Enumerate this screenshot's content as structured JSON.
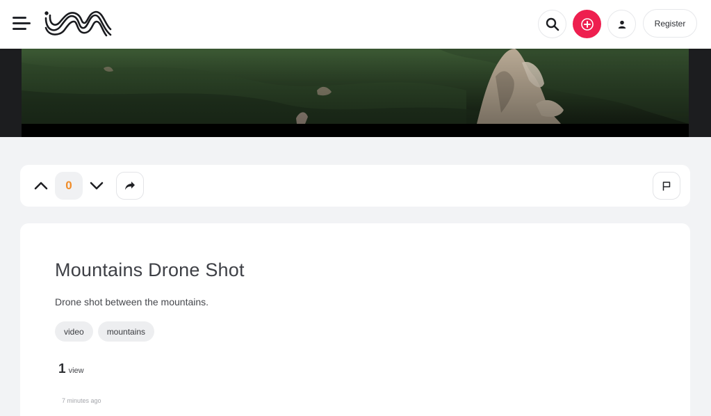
{
  "header": {
    "menu_icon": "hamburger-menu-icon",
    "logo_icon": "wave-logo-icon",
    "search_icon": "search-icon",
    "add_icon": "plus-circle-icon",
    "user_icon": "user-icon",
    "register_label": "Register",
    "accent_color": "#ee1f4f"
  },
  "video": {
    "thumbnail": "mountain-forest-aerial"
  },
  "actions": {
    "upvote_icon": "chevron-up-icon",
    "vote_count": "0",
    "downvote_icon": "chevron-down-icon",
    "share_icon": "share-arrow-icon",
    "report_icon": "flag-icon",
    "vote_color": "#f08c28"
  },
  "post": {
    "title": "Mountains Drone Shot",
    "description": "Drone shot between the mountains.",
    "tags": [
      "video",
      "mountains"
    ],
    "views_count": "1",
    "views_label": "view",
    "timestamp": "7 minutes ago"
  }
}
